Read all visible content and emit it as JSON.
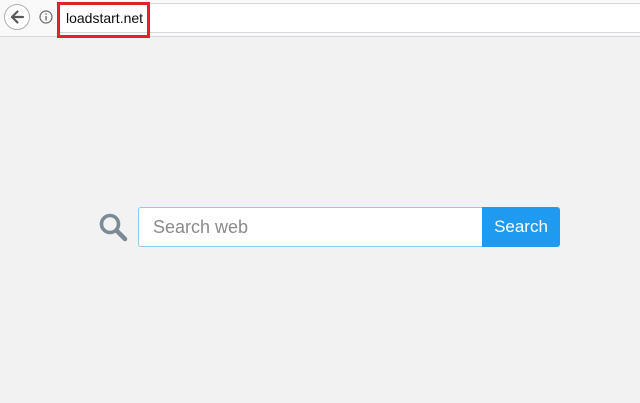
{
  "browser": {
    "url": "loadstart.net",
    "back_icon": "back-arrow-icon",
    "info_icon": "info-icon",
    "highlight_color": "#e0232b"
  },
  "search": {
    "placeholder": "Search web",
    "button_label": "Search",
    "icon": "magnifier-icon",
    "button_color": "#1e9bf0"
  }
}
